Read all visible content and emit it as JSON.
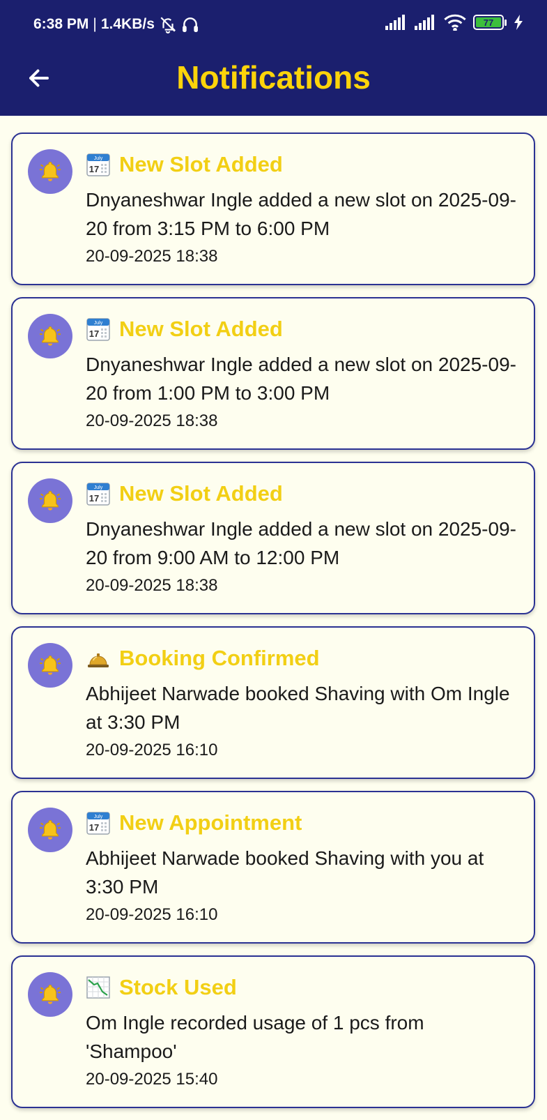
{
  "status_bar": {
    "time": "6:38 PM",
    "separator": "|",
    "network_speed": "1.4KB/s",
    "battery_level": "77",
    "icons": [
      "bell-off-icon",
      "headphones-icon",
      "signal-icon",
      "signal-icon",
      "wifi-icon",
      "battery-icon",
      "charging-icon"
    ]
  },
  "app_bar": {
    "title": "Notifications",
    "back_icon": "arrow-left-icon"
  },
  "colors": {
    "header_bg": "#1b1f6e",
    "title_yellow": "#fdd40a",
    "card_border": "#2b3293",
    "avatar_bg": "#7a73d6",
    "page_bg": "#fefeef"
  },
  "notifications": [
    {
      "icon": "calendar-icon",
      "title": "New Slot Added",
      "message": "Dnyaneshwar Ingle added a new slot on 2025-09-20 from 3:15 PM to 6:00 PM",
      "time": "20-09-2025 18:38"
    },
    {
      "icon": "calendar-icon",
      "title": "New Slot Added",
      "message": "Dnyaneshwar Ingle added a new slot on 2025-09-20 from 1:00 PM to 3:00 PM",
      "time": "20-09-2025 18:38"
    },
    {
      "icon": "calendar-icon",
      "title": "New Slot Added",
      "message": "Dnyaneshwar Ingle added a new slot on 2025-09-20 from 9:00 AM to 12:00 PM",
      "time": "20-09-2025 18:38"
    },
    {
      "icon": "service-bell-icon",
      "title": "Booking Confirmed",
      "message": "Abhijeet Narwade booked Shaving with Om Ingle at 3:30 PM",
      "time": "20-09-2025 16:10"
    },
    {
      "icon": "calendar-icon",
      "title": "New Appointment",
      "message": "Abhijeet Narwade booked Shaving with you at 3:30 PM",
      "time": "20-09-2025 16:10"
    },
    {
      "icon": "chart-decreasing-icon",
      "title": "Stock Used",
      "message": "Om Ingle recorded usage of 1 pcs from 'Shampoo'",
      "time": "20-09-2025 15:40"
    }
  ]
}
